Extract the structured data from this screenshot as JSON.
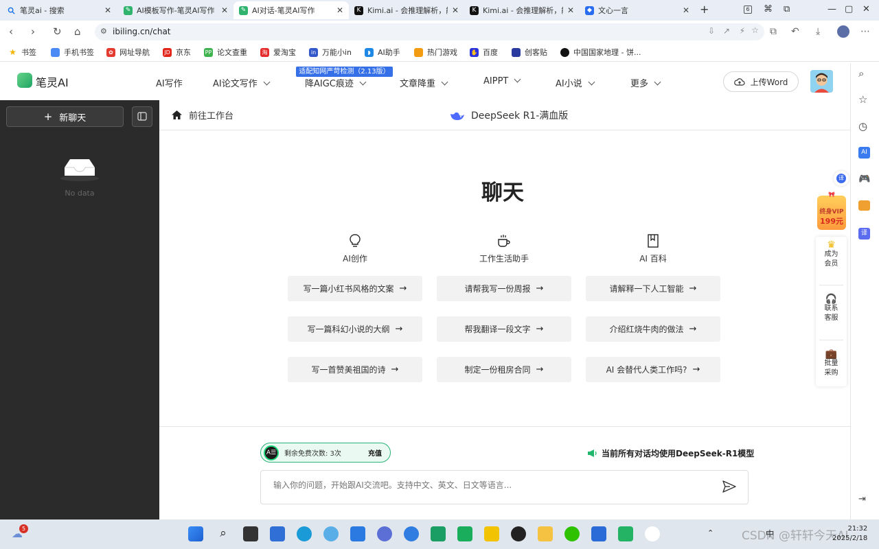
{
  "browser": {
    "tabs": [
      {
        "title": "笔灵ai - 搜索",
        "favicon": "search-icon",
        "active": false
      },
      {
        "title": "AI模板写作-笔灵AI写作",
        "favicon": "bilinglogo-icon",
        "active": false
      },
      {
        "title": "AI对话-笔灵AI写作",
        "favicon": "bilinglogo-icon",
        "active": true
      },
      {
        "title": "Kimi.ai - 会推理解析，能",
        "favicon": "kimi-icon",
        "active": false
      },
      {
        "title": "Kimi.ai - 会推理解析，能",
        "favicon": "kimi-icon",
        "active": false
      },
      {
        "title": "文心一言",
        "favicon": "wenxin-icon",
        "active": false
      }
    ],
    "tab_count": "6",
    "url": "ibiling.cn/chat",
    "bookmarks": [
      {
        "label": "书签",
        "icon": "star-icon"
      },
      {
        "label": "手机书签",
        "icon": "phone-icon"
      },
      {
        "label": "网址导航",
        "icon": "nav-icon"
      },
      {
        "label": "京东",
        "icon": "jd-icon"
      },
      {
        "label": "论文查重",
        "icon": "pp-icon"
      },
      {
        "label": "爱淘宝",
        "icon": "taobao-icon"
      },
      {
        "label": "万能小in",
        "icon": "in-icon"
      },
      {
        "label": "AI助手",
        "icon": "ai-helper-icon"
      },
      {
        "label": "热门游戏",
        "icon": "game-icon"
      },
      {
        "label": "百度",
        "icon": "baidu-icon"
      },
      {
        "label": "创客贴",
        "icon": "chuangke-icon"
      },
      {
        "label": "中国国家地理 - 饼...",
        "icon": "dili-icon"
      }
    ]
  },
  "site": {
    "logo": "笔灵AI",
    "nav": [
      {
        "label": "AI写作",
        "has_dropdown": false
      },
      {
        "label": "AI论文写作",
        "has_dropdown": true
      },
      {
        "label": "降AIGC痕迹",
        "has_dropdown": true
      },
      {
        "label": "文章降重",
        "has_dropdown": true
      },
      {
        "label": "AIPPT",
        "has_dropdown": true
      },
      {
        "label": "AI小说",
        "has_dropdown": true
      },
      {
        "label": "更多",
        "has_dropdown": true
      }
    ],
    "nav_badge": "适配知网严苛检测（2.13版）",
    "upload_label": "上传Word",
    "brand_color": "#1fa463",
    "badge_color": "#3570e8"
  },
  "sidebar": {
    "new_chat": "新聊天",
    "empty_text": "No data"
  },
  "chat": {
    "home_link": "前往工作台",
    "model_name": "DeepSeek R1-满血版",
    "title": "聊天",
    "categories": [
      {
        "label": "AI创作",
        "icon": "lightbulb-icon",
        "prompts": [
          "写一篇小红书风格的文案",
          "写一篇科幻小说的大纲",
          "写一首赞美祖国的诗"
        ]
      },
      {
        "label": "工作生活助手",
        "icon": "coffee-icon",
        "prompts": [
          "请帮我写一份周报",
          "帮我翻译一段文字",
          "制定一份租房合同"
        ]
      },
      {
        "label": "AI 百科",
        "icon": "bookmark-icon",
        "prompts": [
          "请解释一下人工智能",
          "介绍红烧牛肉的做法",
          "AI 会替代人类工作吗?"
        ]
      }
    ],
    "quota_text": "剩余免费次数: 3次",
    "recharge": "充值",
    "notice": "当前所有对话均使用DeepSeek-R1模型",
    "input_placeholder": "输入你的问题，开始跟AI交流吧。支持中文、英文、日文等语言..."
  },
  "floating": {
    "translate": "译",
    "vip_line1": "终身VIP",
    "vip_price": "199元",
    "member": "成为会员",
    "service": "联系客服",
    "bulk": "批量采购"
  },
  "taskbar": {
    "notification_count": "5",
    "ime": "中",
    "time": "21:32",
    "date": "2025/2/18",
    "watermark": "CSDN @轩轩今天AI"
  }
}
